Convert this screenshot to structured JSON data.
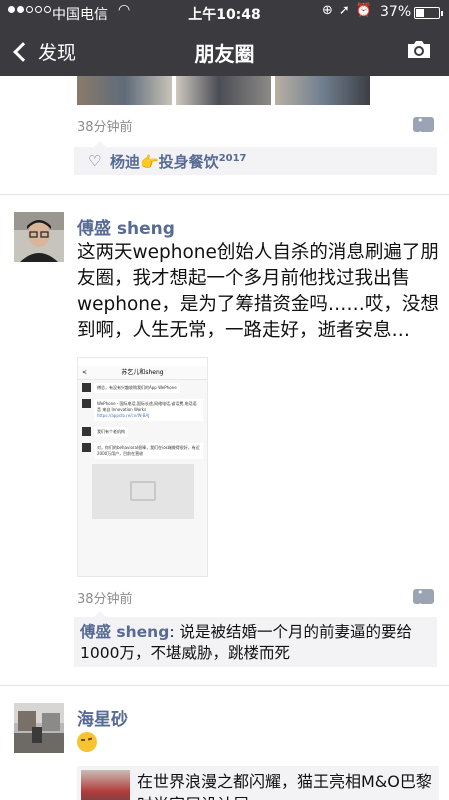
{
  "status_bar": {
    "carrier": "中国电信",
    "time": "上午10:48",
    "battery": "37%",
    "battery_level": 0.37
  },
  "nav": {
    "back_label": "发现",
    "title": "朋友圈"
  },
  "colors": {
    "nav_bg": "#3a3a3f",
    "link_blue": "#576b95",
    "comment_bg": "#f3f3f5"
  },
  "posts": [
    {
      "time": "38分钟前",
      "likes": {
        "names": "杨迪👉投身餐饮",
        "superscript": "2017"
      }
    },
    {
      "author": "傅盛 sheng",
      "text": "这两天wephone创始人自杀的消息刷遍了朋友圈，我才想起一个多月前他找过我出售wephone，是为了筹措资金吗……哎，没想到啊，人生无常，一路走好，逝者安息…\n…",
      "screenshot": {
        "title": "苏乞儿和sheng",
        "msg1": "傅总，有没有兴趣收购我们的App WePhone",
        "msg2": "WePhone - 国际电话,国际长途,网络电话,省话费,电话语音 来自 Innovation Works",
        "msg2_link": "https://appsto.re/cn/W-BAJ",
        "msg3": "我们有个老机构",
        "msg4": "对，你们的behavioral很棒，我们在ios端做得很好，有近2000万用户，目前在营收"
      },
      "time": "38分钟前",
      "comment": {
        "author": "傅盛 sheng",
        "text": ": 说是被结婚一个月的前妻逼的要给1000万，不堪威胁，跳楼而死"
      }
    },
    {
      "author": "海星砂",
      "link_title": "在世界浪漫之都闪耀，猫王亮相M&O巴黎时尚家居设计展"
    }
  ]
}
